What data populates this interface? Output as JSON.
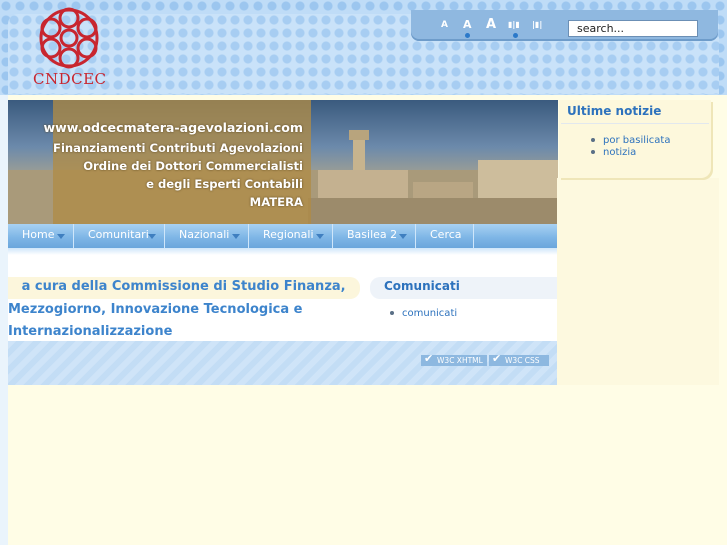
{
  "logo": {
    "text": "CNDCEC",
    "color": "#c8262f",
    "icon": "cndcec-knot-logo-icon"
  },
  "toolbox": {
    "font_small": "A",
    "font_medium": "A",
    "font_large": "A",
    "layout_narrow": "▮|▮",
    "layout_wide": "|▮|",
    "search_placeholder": "search..."
  },
  "banner": {
    "lines": [
      "www.odcecmatera-agevolazioni.com",
      "Finanziamenti Contributi Agevolazioni",
      "Ordine dei Dottori Commercialisti",
      "e degli Esperti Contabili",
      "MATERA"
    ]
  },
  "menu": {
    "items": [
      {
        "label": "Home",
        "has_dropdown": true
      },
      {
        "label": "Comunitari",
        "has_dropdown": true
      },
      {
        "label": "Nazionali",
        "has_dropdown": true
      },
      {
        "label": "Regionali",
        "has_dropdown": true
      },
      {
        "label": "Basilea 2",
        "has_dropdown": true
      },
      {
        "label": "Cerca",
        "has_dropdown": false
      }
    ]
  },
  "intro": {
    "line1": "   a cura della Commissione di Studio Finanza,",
    "line2": "Mezzogiorno, Innovazione Tecnologica e",
    "line3": "Internazionalizzazione"
  },
  "comunicati": {
    "title": "Comunicati",
    "items": [
      "comunicati"
    ]
  },
  "sidebar": {
    "title": "Ultime notizie",
    "items": [
      "por basilicata",
      "notizia"
    ]
  },
  "footer": {
    "badge_xhtml": "W3C XHTML",
    "badge_css": "W3C CSS"
  },
  "colors": {
    "accent": "#2d72bd",
    "menu": "#7fb6e6",
    "background": "#fffde6"
  }
}
